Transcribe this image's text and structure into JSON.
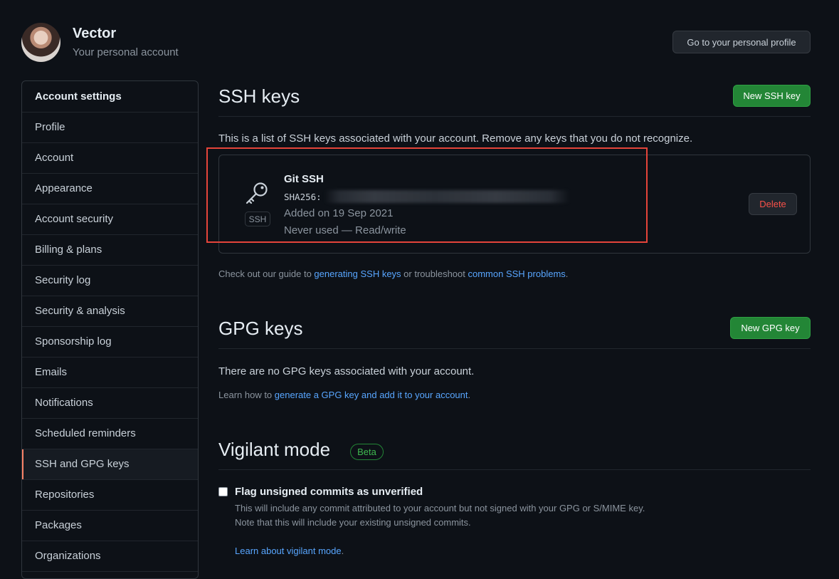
{
  "account": {
    "name": "Vector",
    "subtitle": "Your personal account",
    "profile_button": "Go to your personal profile"
  },
  "sidebar": {
    "header": "Account settings",
    "items": [
      {
        "label": "Profile"
      },
      {
        "label": "Account"
      },
      {
        "label": "Appearance"
      },
      {
        "label": "Account security"
      },
      {
        "label": "Billing & plans"
      },
      {
        "label": "Security log"
      },
      {
        "label": "Security & analysis"
      },
      {
        "label": "Sponsorship log"
      },
      {
        "label": "Emails"
      },
      {
        "label": "Notifications"
      },
      {
        "label": "Scheduled reminders"
      },
      {
        "label": "SSH and GPG keys",
        "active": true
      },
      {
        "label": "Repositories"
      },
      {
        "label": "Packages"
      },
      {
        "label": "Organizations"
      }
    ]
  },
  "ssh": {
    "title": "SSH keys",
    "new_button": "New SSH key",
    "description": "This is a list of SSH keys associated with your account. Remove any keys that you do not recognize.",
    "key": {
      "name": "Git SSH",
      "fingerprint_prefix": "SHA256:",
      "badge": "SSH",
      "added": "Added on 19 Sep 2021",
      "usage": "Never used — Read/write",
      "delete_button": "Delete"
    },
    "guide_prefix": "Check out our guide to ",
    "guide_link1": "generating SSH keys",
    "guide_middle": " or troubleshoot ",
    "guide_link2": "common SSH problems",
    "guide_suffix": "."
  },
  "gpg": {
    "title": "GPG keys",
    "new_button": "New GPG key",
    "empty": "There are no GPG keys associated with your account.",
    "learn_prefix": "Learn how to ",
    "learn_link": "generate a GPG key and add it to your account",
    "learn_suffix": "."
  },
  "vigilant": {
    "title": "Vigilant mode",
    "badge": "Beta",
    "checkbox_label": "Flag unsigned commits as unverified",
    "desc1": "This will include any commit attributed to your account but not signed with your GPG or S/MIME key.",
    "desc2": "Note that this will include your existing unsigned commits.",
    "learn_link": "Learn about vigilant mode",
    "learn_suffix": "."
  },
  "colors": {
    "background": "#0d1117",
    "accent_green": "#238636",
    "link": "#58a6ff",
    "danger": "#f85149",
    "highlight": "#e5443a"
  }
}
